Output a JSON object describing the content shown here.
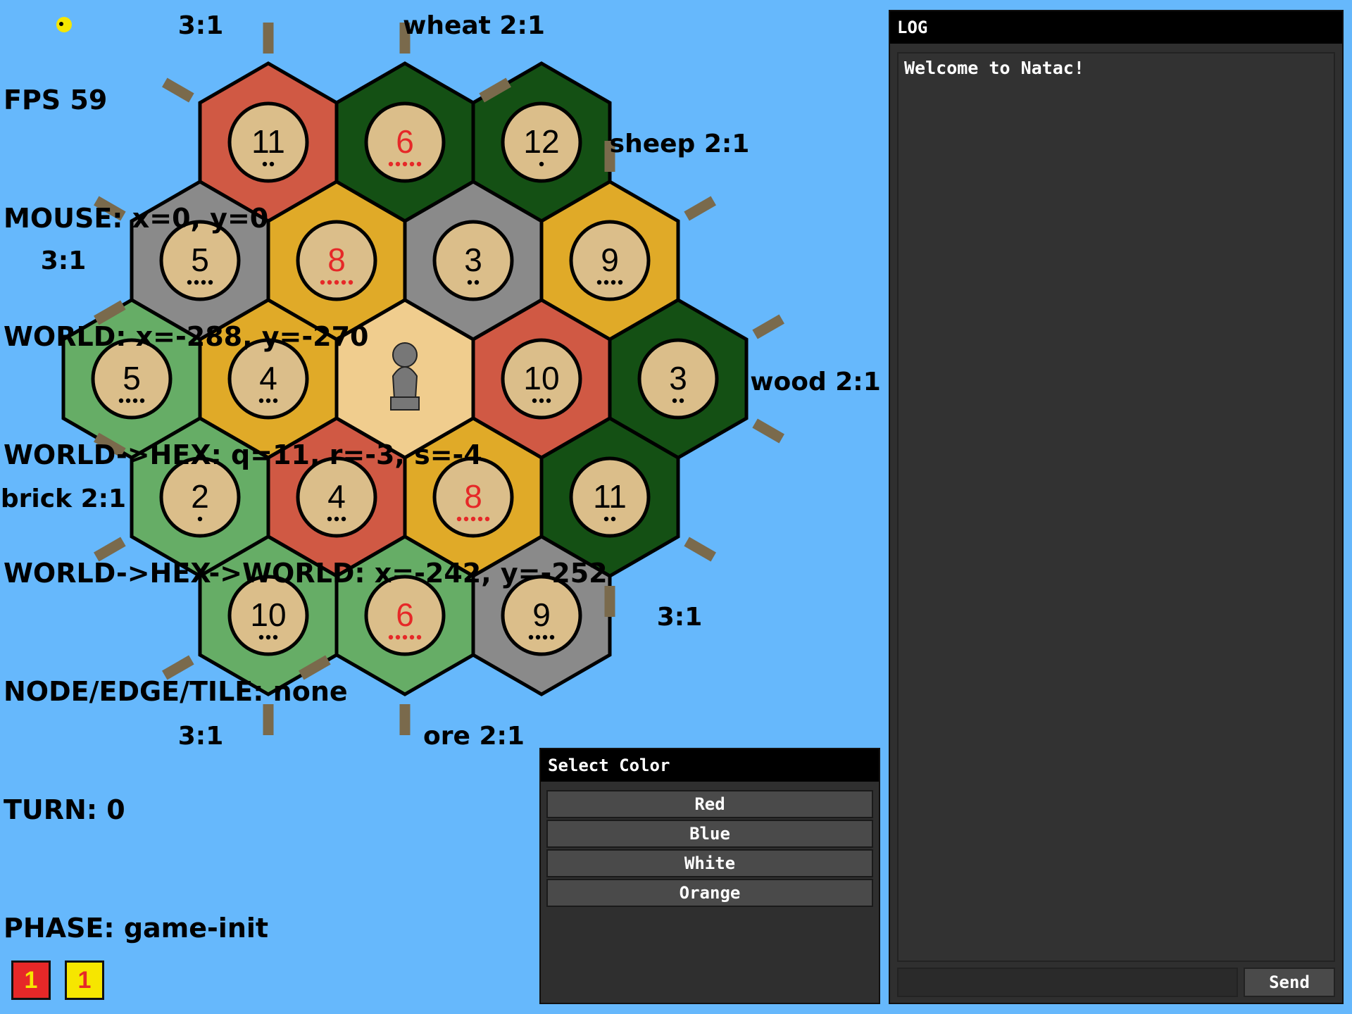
{
  "debug": {
    "lines": [
      "FPS 59",
      "MOUSE: x=0, y=0",
      "WORLD: x=-288, y=-270",
      "WORLD->HEX: q=11, r=-3, s=-4",
      "WORLD->HEX->WORLD: x=-242, y=-252",
      "NODE/EDGE/TILE: none",
      "TURN: 0",
      "PHASE: game-init"
    ]
  },
  "colors": {
    "water": "#66b8fc",
    "forest": "#145014",
    "pasture": "#66ad66",
    "fields": "#e0aa28",
    "hills": "#d05944",
    "mountains": "#8a8a8a",
    "desert": "#f0cd8e",
    "token": "#dbbe8a",
    "hot_number": "#e62828"
  },
  "board": {
    "tiles": [
      {
        "resource": "hills",
        "number": "11",
        "pips": 2
      },
      {
        "resource": "forest",
        "number": "6",
        "pips": 5
      },
      {
        "resource": "forest",
        "number": "12",
        "pips": 1
      },
      {
        "resource": "mountains",
        "number": "5",
        "pips": 4
      },
      {
        "resource": "fields",
        "number": "8",
        "pips": 5
      },
      {
        "resource": "mountains",
        "number": "3",
        "pips": 2
      },
      {
        "resource": "fields",
        "number": "9",
        "pips": 4
      },
      {
        "resource": "pasture",
        "number": "5",
        "pips": 4
      },
      {
        "resource": "fields",
        "number": "4",
        "pips": 3
      },
      {
        "resource": "desert",
        "number": "",
        "pips": 0
      },
      {
        "resource": "hills",
        "number": "10",
        "pips": 3
      },
      {
        "resource": "forest",
        "number": "3",
        "pips": 2
      },
      {
        "resource": "pasture",
        "number": "2",
        "pips": 1
      },
      {
        "resource": "hills",
        "number": "4",
        "pips": 3
      },
      {
        "resource": "fields",
        "number": "8",
        "pips": 5
      },
      {
        "resource": "forest",
        "number": "11",
        "pips": 2
      },
      {
        "resource": "pasture",
        "number": "10",
        "pips": 3
      },
      {
        "resource": "pasture",
        "number": "6",
        "pips": 5
      },
      {
        "resource": "mountains",
        "number": "9",
        "pips": 4
      }
    ],
    "ports": [
      {
        "label": "3:1"
      },
      {
        "label": "wheat 2:1"
      },
      {
        "label": "sheep 2:1"
      },
      {
        "label": "wood 2:1"
      },
      {
        "label": "3:1"
      },
      {
        "label": "ore 2:1"
      },
      {
        "label": "3:1"
      },
      {
        "label": "brick 2:1"
      },
      {
        "label": "3:1"
      }
    ]
  },
  "log": {
    "title": "LOG",
    "messages": [
      "Welcome to Natac!"
    ],
    "send_label": "Send"
  },
  "color_select": {
    "title": "Select Color",
    "options": [
      "Red",
      "Blue",
      "White",
      "Orange"
    ]
  },
  "players": [
    {
      "value": "1",
      "color": "#e62828",
      "text_color": "#f6e600"
    },
    {
      "value": "1",
      "color": "#f6e600",
      "text_color": "#e62828"
    }
  ]
}
